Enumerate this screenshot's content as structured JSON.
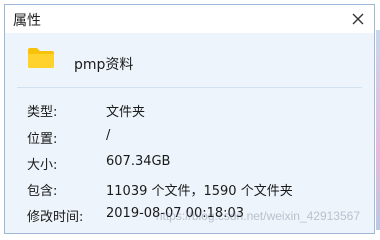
{
  "window": {
    "title": "属性",
    "close_icon": "close-icon"
  },
  "file": {
    "icon": "folder-icon",
    "name": "pmp资料"
  },
  "properties": [
    {
      "label": "类型:",
      "value": "文件夹"
    },
    {
      "label": "位置:",
      "value": "/"
    },
    {
      "label": "大小:",
      "value": "607.34GB"
    },
    {
      "label": "包含:",
      "value": "11039 个文件，1590 个文件夹"
    },
    {
      "label": "修改时间:",
      "value": "2019-08-07 00:18:03"
    }
  ],
  "watermark": "https://blog.csdn.net/weixin_42913567",
  "colors": {
    "folder": "#f6c20a",
    "panel_bg": "#eef4fb",
    "border": "#9fb8d6"
  }
}
